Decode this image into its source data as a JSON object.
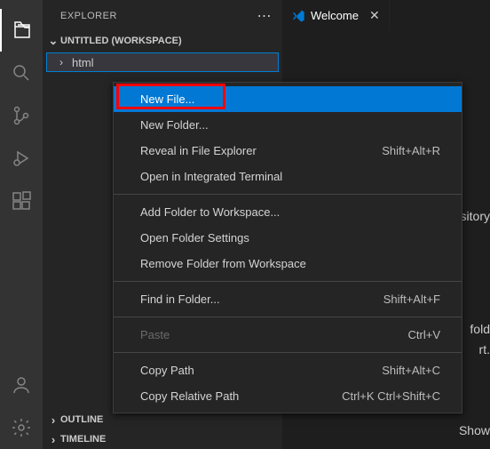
{
  "activityBar": {
    "icons": [
      "files",
      "search",
      "source-control",
      "debug",
      "extensions"
    ],
    "bottomIcons": [
      "account",
      "settings"
    ]
  },
  "sidebar": {
    "title": "EXPLORER",
    "workspaceLabel": "UNTITLED (WORKSPACE)",
    "folderName": "html",
    "outlineLabel": "OUTLINE",
    "timelineLabel": "TIMELINE"
  },
  "tab": {
    "label": "Welcome"
  },
  "contextMenu": {
    "items": [
      {
        "label": "New File...",
        "shortcut": "",
        "highlighted": true
      },
      {
        "label": "New Folder...",
        "shortcut": ""
      },
      {
        "label": "Reveal in File Explorer",
        "shortcut": "Shift+Alt+R"
      },
      {
        "label": "Open in Integrated Terminal",
        "shortcut": ""
      }
    ],
    "group2": [
      {
        "label": "Add Folder to Workspace...",
        "shortcut": ""
      },
      {
        "label": "Open Folder Settings",
        "shortcut": ""
      },
      {
        "label": "Remove Folder from Workspace",
        "shortcut": ""
      }
    ],
    "group3": [
      {
        "label": "Find in Folder...",
        "shortcut": "Shift+Alt+F"
      }
    ],
    "group4": [
      {
        "label": "Paste",
        "shortcut": "Ctrl+V",
        "disabled": true
      }
    ],
    "group5": [
      {
        "label": "Copy Path",
        "shortcut": "Shift+Alt+C"
      },
      {
        "label": "Copy Relative Path",
        "shortcut": "Ctrl+K Ctrl+Shift+C"
      }
    ]
  },
  "editorFragments": {
    "link": "ository",
    "text1": "fold",
    "text2": "rt.",
    "text3": "Show"
  }
}
